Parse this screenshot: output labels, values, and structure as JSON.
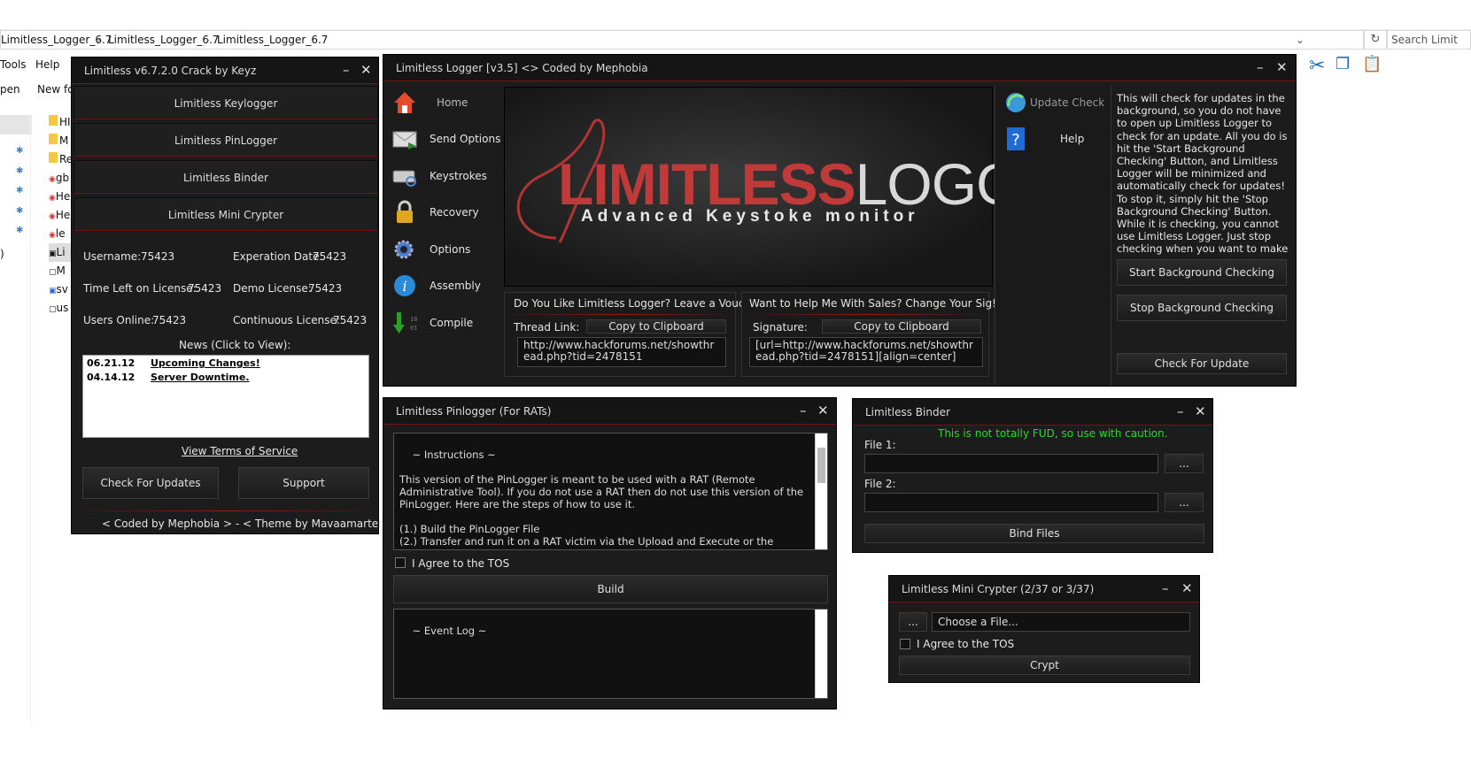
{
  "explorer": {
    "breadcrumb": [
      "Limitless_Logger_6.7",
      "Limitless_Logger_6.7",
      "Limitless_Logger_6.7"
    ],
    "search_placeholder": "Search Limit",
    "menu": [
      "Tools",
      "Help"
    ],
    "toolbar": [
      "pen",
      "New fo"
    ],
    "files": [
      "HI",
      "M",
      "Re",
      "gb",
      "He",
      "He",
      "le",
      "Li",
      "M",
      "sv",
      "us"
    ],
    "left_char": ")"
  },
  "crack": {
    "title": "Limitless v6.7.2.0 Crack by Keyz",
    "buttons": [
      "Limitless Keylogger",
      "Limitless PinLogger",
      "Limitless Binder",
      "Limitless Mini Crypter"
    ],
    "fields": {
      "username_label": "Username:",
      "username": "75423",
      "expiration_label": "Experation Date:",
      "expiration": "75423",
      "time_left_label": "Time Left on License:",
      "time_left": "75423",
      "demo_label": "Demo License:",
      "demo": "75423",
      "users_online_label": "Users Online:",
      "users_online": "75423",
      "continuous_label": "Continuous License:",
      "continuous": "75423"
    },
    "news_label": "News (Click to View):",
    "news": [
      {
        "date": "06.21.12",
        "title": "Upcoming Changes!"
      },
      {
        "date": "04.14.12",
        "title": "Server Downtime."
      }
    ],
    "tos_link": "View Terms of Service",
    "check_updates": "Check For Updates",
    "support": "Support",
    "footer": "< Coded by Mephobia > - < Theme by Mavaamarten >"
  },
  "main": {
    "title": "Limitless Logger [v3.5] <> Coded by Mephobia",
    "nav": [
      "Home",
      "Send Options",
      "Keystrokes",
      "Recovery",
      "Options",
      "Assembly",
      "Compile"
    ],
    "banner_word1": "LIMITLESS",
    "banner_word2": "LOGGER",
    "banner_sub": "Advanced Keystoke monitor",
    "vouch_heading": "Do You Like Limitless Logger?  Leave a Vouch!",
    "thread_label": "Thread Link:",
    "copy1": "Copy to Clipboard",
    "thread_url": "http://www.hackforums.net/showthread.php?tid=2478151",
    "sig_heading": "Want to Help Me With Sales? Change Your Sig!",
    "sig_label": "Signature:",
    "copy2": "Copy to Clipboard",
    "sig_value": "[url=http://www.hackforums.net/showthread.php?tid=2478151][align=center]",
    "update_check": "Update Check",
    "help": "Help",
    "update_info": "This will check for updates in the background, so you do not have to open up Limitless Logger to check for an update. All you do is hit the 'Start Background Checking' Button, and Limitless Logger will be minimized and automatically check for updates! To stop it, simply hit the 'Stop Background Checking' Button. While it is checking, you cannot use Limitless Logger. Just stop checking when you want to make a new server.",
    "start_bg": "Start Background Checking",
    "stop_bg": "Stop Background Checking",
    "check_update": "Check For Update"
  },
  "pin": {
    "title": "Limitless Pinlogger (For RATs)",
    "instructions": "~ Instructions ~\n\nThis version of the PinLogger is meant to be used with a RAT (Remote Administrative Tool). If you do not use a RAT then do not use this version of the PinLogger. Here are the steps of how to use it.\n\n(1.) Build the PinLogger File\n(2.) Transfer and run it on a RAT victim via the Upload and Execute or the Download and Execute in the RAT",
    "agree": "I Agree to the TOS",
    "build": "Build",
    "event_log": "~ Event Log ~"
  },
  "binder": {
    "title": "Limitless Binder",
    "warning": "This is not totally FUD, so use with caution.",
    "file1": "File 1:",
    "file2": "File 2:",
    "browse": "...",
    "bind": "Bind Files"
  },
  "crypter": {
    "title": "Limitless Mini Crypter (2/37 or 3/37)",
    "browse": "...",
    "choose": "Choose a File...",
    "agree": "I Agree to the TOS",
    "crypt": "Crypt"
  },
  "window_controls": {
    "minimize": "–",
    "close": "✕"
  },
  "colors": {
    "accent_red": "#a01818",
    "dark_bg": "#1c1c1c",
    "warning_green": "#22dd22"
  }
}
